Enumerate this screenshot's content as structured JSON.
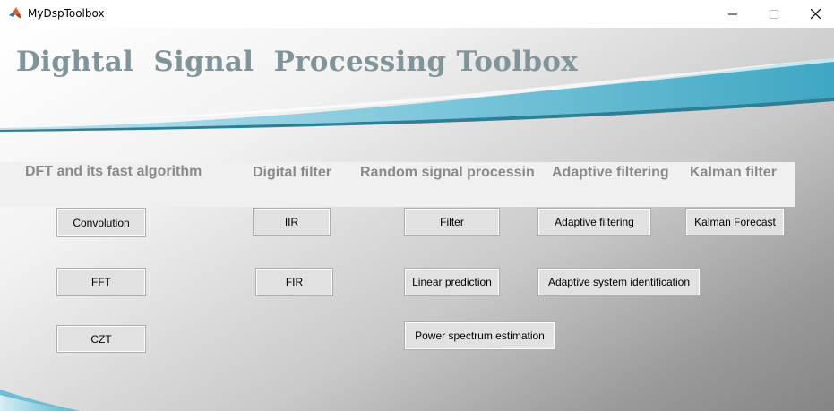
{
  "window": {
    "title": "MyDspToolbox",
    "controls": {
      "minimize": "—",
      "maximize": "☐",
      "close": "✕"
    }
  },
  "app": {
    "title": "Dightal  Signal  Processing Toolbox",
    "accent_color": "#4aaec7",
    "title_color": "#7f959a"
  },
  "categories": {
    "dft": "DFT and its fast algorithm",
    "digital_filter": "Digital filter",
    "random": "Random signal processin",
    "adaptive": "Adaptive filtering",
    "kalman": "Kalman filter"
  },
  "buttons": {
    "convolution": "Convolution",
    "fft": "FFT",
    "czt": "CZT",
    "iir": "IIR",
    "fir": "FIR",
    "filter": "Filter",
    "linear_prediction": "Linear prediction",
    "power_spectrum": "Power spectrum estimation",
    "adaptive_filtering": "Adaptive filtering",
    "adaptive_system_id": "Adaptive system identification",
    "kalman_forecast": "Kalman Forecast"
  },
  "icons": {
    "app": "matlab-icon"
  }
}
